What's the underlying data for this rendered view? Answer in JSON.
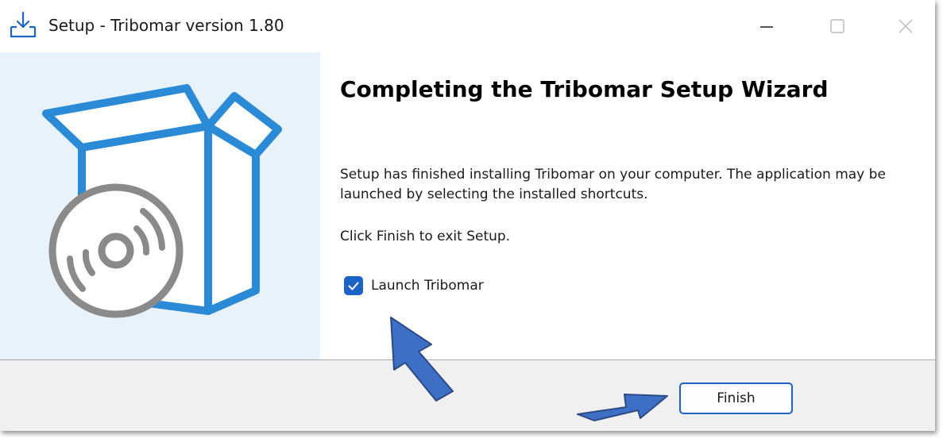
{
  "window": {
    "title": "Setup - Tribomar version 1.80",
    "icon": "download-tray-icon",
    "controls": [
      "minimize-icon",
      "maximize-icon",
      "close-icon"
    ]
  },
  "wizard": {
    "heading": "Completing the Tribomar Setup Wizard",
    "body": "Setup has finished installing Tribomar on your computer. The application may be launched by selecting the installed shortcuts.",
    "exit_instruction": "Click Finish to exit Setup.",
    "launch_checkbox": {
      "label": "Launch Tribomar",
      "checked": true
    },
    "banner_icon": "software-box-with-disc-icon"
  },
  "footer": {
    "finish_label": "Finish"
  },
  "colors": {
    "accent": "#1d63c6",
    "banner_bg": "#e8f2fa",
    "box_outline": "#2a8ad6",
    "disc_gray": "#8a8a8a",
    "footer_bg": "#f0f0f0",
    "annotation_arrow": "#3d6fc4"
  }
}
